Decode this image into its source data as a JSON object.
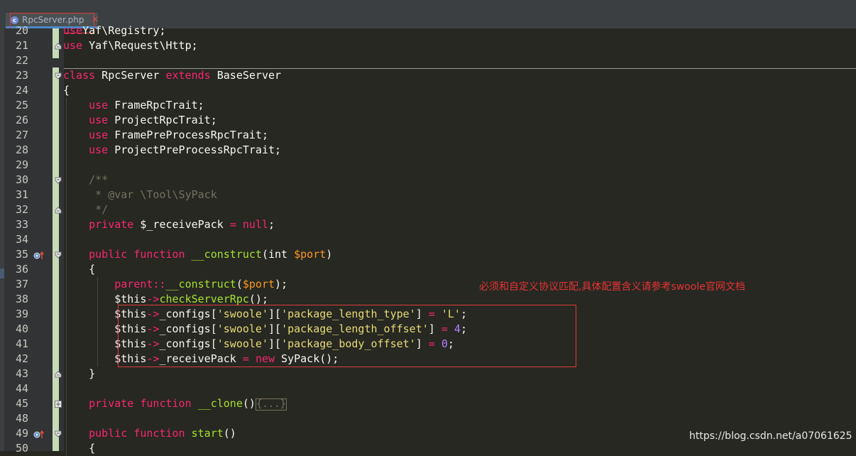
{
  "tab": {
    "filename": "RpcServer.php",
    "close_glyph": "×",
    "file_icon": "php-file-icon"
  },
  "annotation": "必须和自定义协议匹配,具体配置含义请参考swoole官网文档",
  "watermark": "https://blog.csdn.net/a07061625",
  "colors": {
    "background": "#272822",
    "keyword": "#f92672",
    "function": "#a6e22e",
    "string": "#e6db74",
    "number": "#ae81ff",
    "comment": "#75715e",
    "annotation": "#e53333"
  },
  "lines": [
    {
      "n": "20",
      "tokens": [
        [
          "kw",
          "use"
        ],
        [
          "",
          "Yaf\\Registry;"
        ]
      ]
    },
    {
      "n": "21",
      "tokens": [
        [
          "kw",
          "use"
        ],
        [
          "",
          " Yaf\\Request\\Http;"
        ]
      ]
    },
    {
      "n": "22",
      "tokens": []
    },
    {
      "n": "23",
      "tokens": [
        [
          "kw",
          "class"
        ],
        [
          "",
          " RpcServer "
        ],
        [
          "kw",
          "extends"
        ],
        [
          "",
          " BaseServer"
        ]
      ]
    },
    {
      "n": "24",
      "tokens": [
        [
          "",
          "{"
        ]
      ]
    },
    {
      "n": "25",
      "tokens": [
        [
          "",
          "    "
        ],
        [
          "kw",
          "use"
        ],
        [
          "",
          " FrameRpcTrait;"
        ]
      ]
    },
    {
      "n": "26",
      "tokens": [
        [
          "",
          "    "
        ],
        [
          "kw",
          "use"
        ],
        [
          "",
          " ProjectRpcTrait;"
        ]
      ]
    },
    {
      "n": "27",
      "tokens": [
        [
          "",
          "    "
        ],
        [
          "kw",
          "use"
        ],
        [
          "",
          " FramePreProcessRpcTrait;"
        ]
      ]
    },
    {
      "n": "28",
      "tokens": [
        [
          "",
          "    "
        ],
        [
          "kw",
          "use"
        ],
        [
          "",
          " ProjectPreProcessRpcTrait;"
        ]
      ]
    },
    {
      "n": "29",
      "tokens": []
    },
    {
      "n": "30",
      "tokens": [
        [
          "cm",
          "    /**"
        ]
      ]
    },
    {
      "n": "31",
      "tokens": [
        [
          "cm",
          "     * @var \\Tool\\SyPack"
        ]
      ]
    },
    {
      "n": "32",
      "tokens": [
        [
          "cm",
          "     */"
        ]
      ]
    },
    {
      "n": "33",
      "tokens": [
        [
          "",
          "    "
        ],
        [
          "kw",
          "private"
        ],
        [
          "",
          " $_receivePack "
        ],
        [
          "kw",
          "="
        ],
        [
          "",
          " "
        ],
        [
          "kw",
          "null"
        ],
        [
          "",
          ";"
        ]
      ]
    },
    {
      "n": "34",
      "tokens": []
    },
    {
      "n": "35",
      "tokens": [
        [
          "",
          "    "
        ],
        [
          "kw",
          "public"
        ],
        [
          "",
          " "
        ],
        [
          "kw",
          "function"
        ],
        [
          "",
          " "
        ],
        [
          "fn",
          "__construct"
        ],
        [
          "",
          "(int "
        ],
        [
          "tk",
          "$port"
        ],
        [
          "",
          ")"
        ]
      ]
    },
    {
      "n": "36",
      "tokens": [
        [
          "",
          "    {"
        ]
      ]
    },
    {
      "n": "37",
      "tokens": [
        [
          "",
          "        "
        ],
        [
          "kw",
          "parent"
        ],
        [
          "kw",
          "::"
        ],
        [
          "fn",
          "__construct"
        ],
        [
          "",
          "("
        ],
        [
          "tk",
          "$port"
        ],
        [
          "",
          ");"
        ]
      ]
    },
    {
      "n": "38",
      "tokens": [
        [
          "",
          "        $this"
        ],
        [
          "kw",
          "->"
        ],
        [
          "fn",
          "checkServerRpc"
        ],
        [
          "",
          "();"
        ]
      ]
    },
    {
      "n": "39",
      "tokens": [
        [
          "",
          "        $this"
        ],
        [
          "kw",
          "->"
        ],
        [
          "",
          "_configs["
        ],
        [
          "str",
          "'swoole'"
        ],
        [
          "",
          "]["
        ],
        [
          "str",
          "'package_length_type'"
        ],
        [
          "",
          "] "
        ],
        [
          "kw",
          "="
        ],
        [
          "",
          " "
        ],
        [
          "str",
          "'L'"
        ],
        [
          "",
          ";"
        ]
      ]
    },
    {
      "n": "40",
      "tokens": [
        [
          "",
          "        $this"
        ],
        [
          "kw",
          "->"
        ],
        [
          "",
          "_configs["
        ],
        [
          "str",
          "'swoole'"
        ],
        [
          "",
          "]["
        ],
        [
          "str",
          "'package_length_offset'"
        ],
        [
          "",
          "] "
        ],
        [
          "kw",
          "="
        ],
        [
          "",
          " "
        ],
        [
          "num",
          "4"
        ],
        [
          "",
          ";"
        ]
      ]
    },
    {
      "n": "41",
      "tokens": [
        [
          "",
          "        $this"
        ],
        [
          "kw",
          "->"
        ],
        [
          "",
          "_configs["
        ],
        [
          "str",
          "'swoole'"
        ],
        [
          "",
          "]["
        ],
        [
          "str",
          "'package_body_offset'"
        ],
        [
          "",
          "] "
        ],
        [
          "kw",
          "="
        ],
        [
          "",
          " "
        ],
        [
          "num",
          "0"
        ],
        [
          "",
          ";"
        ]
      ]
    },
    {
      "n": "42",
      "tokens": [
        [
          "",
          "        $this"
        ],
        [
          "kw",
          "->"
        ],
        [
          "",
          "_receivePack "
        ],
        [
          "kw",
          "="
        ],
        [
          "",
          " "
        ],
        [
          "kw",
          "new"
        ],
        [
          "",
          " SyPack();"
        ]
      ]
    },
    {
      "n": "43",
      "tokens": [
        [
          "",
          "    }"
        ]
      ]
    },
    {
      "n": "44",
      "tokens": []
    },
    {
      "n": "45",
      "tokens": [
        [
          "",
          "    "
        ],
        [
          "kw",
          "private"
        ],
        [
          "",
          " "
        ],
        [
          "kw",
          "function"
        ],
        [
          "",
          " "
        ],
        [
          "fn",
          "__clone"
        ],
        [
          "",
          "()"
        ],
        [
          "fold",
          "{...}"
        ]
      ]
    },
    {
      "n": "48",
      "tokens": []
    },
    {
      "n": "49",
      "tokens": [
        [
          "",
          "    "
        ],
        [
          "kw",
          "public"
        ],
        [
          "",
          " "
        ],
        [
          "kw",
          "function"
        ],
        [
          "",
          " "
        ],
        [
          "fn",
          "start"
        ],
        [
          "",
          "()"
        ]
      ]
    },
    {
      "n": "50",
      "tokens": [
        [
          "",
          "    {"
        ]
      ]
    }
  ],
  "fold_markers": [
    {
      "line": "21",
      "kind": "end"
    },
    {
      "line": "23",
      "kind": "start"
    },
    {
      "line": "30",
      "kind": "start"
    },
    {
      "line": "32",
      "kind": "end"
    },
    {
      "line": "35",
      "kind": "start"
    },
    {
      "line": "43",
      "kind": "end"
    },
    {
      "line": "45",
      "kind": "collapsed"
    },
    {
      "line": "49",
      "kind": "start"
    }
  ],
  "override_markers": [
    "35",
    "49"
  ]
}
